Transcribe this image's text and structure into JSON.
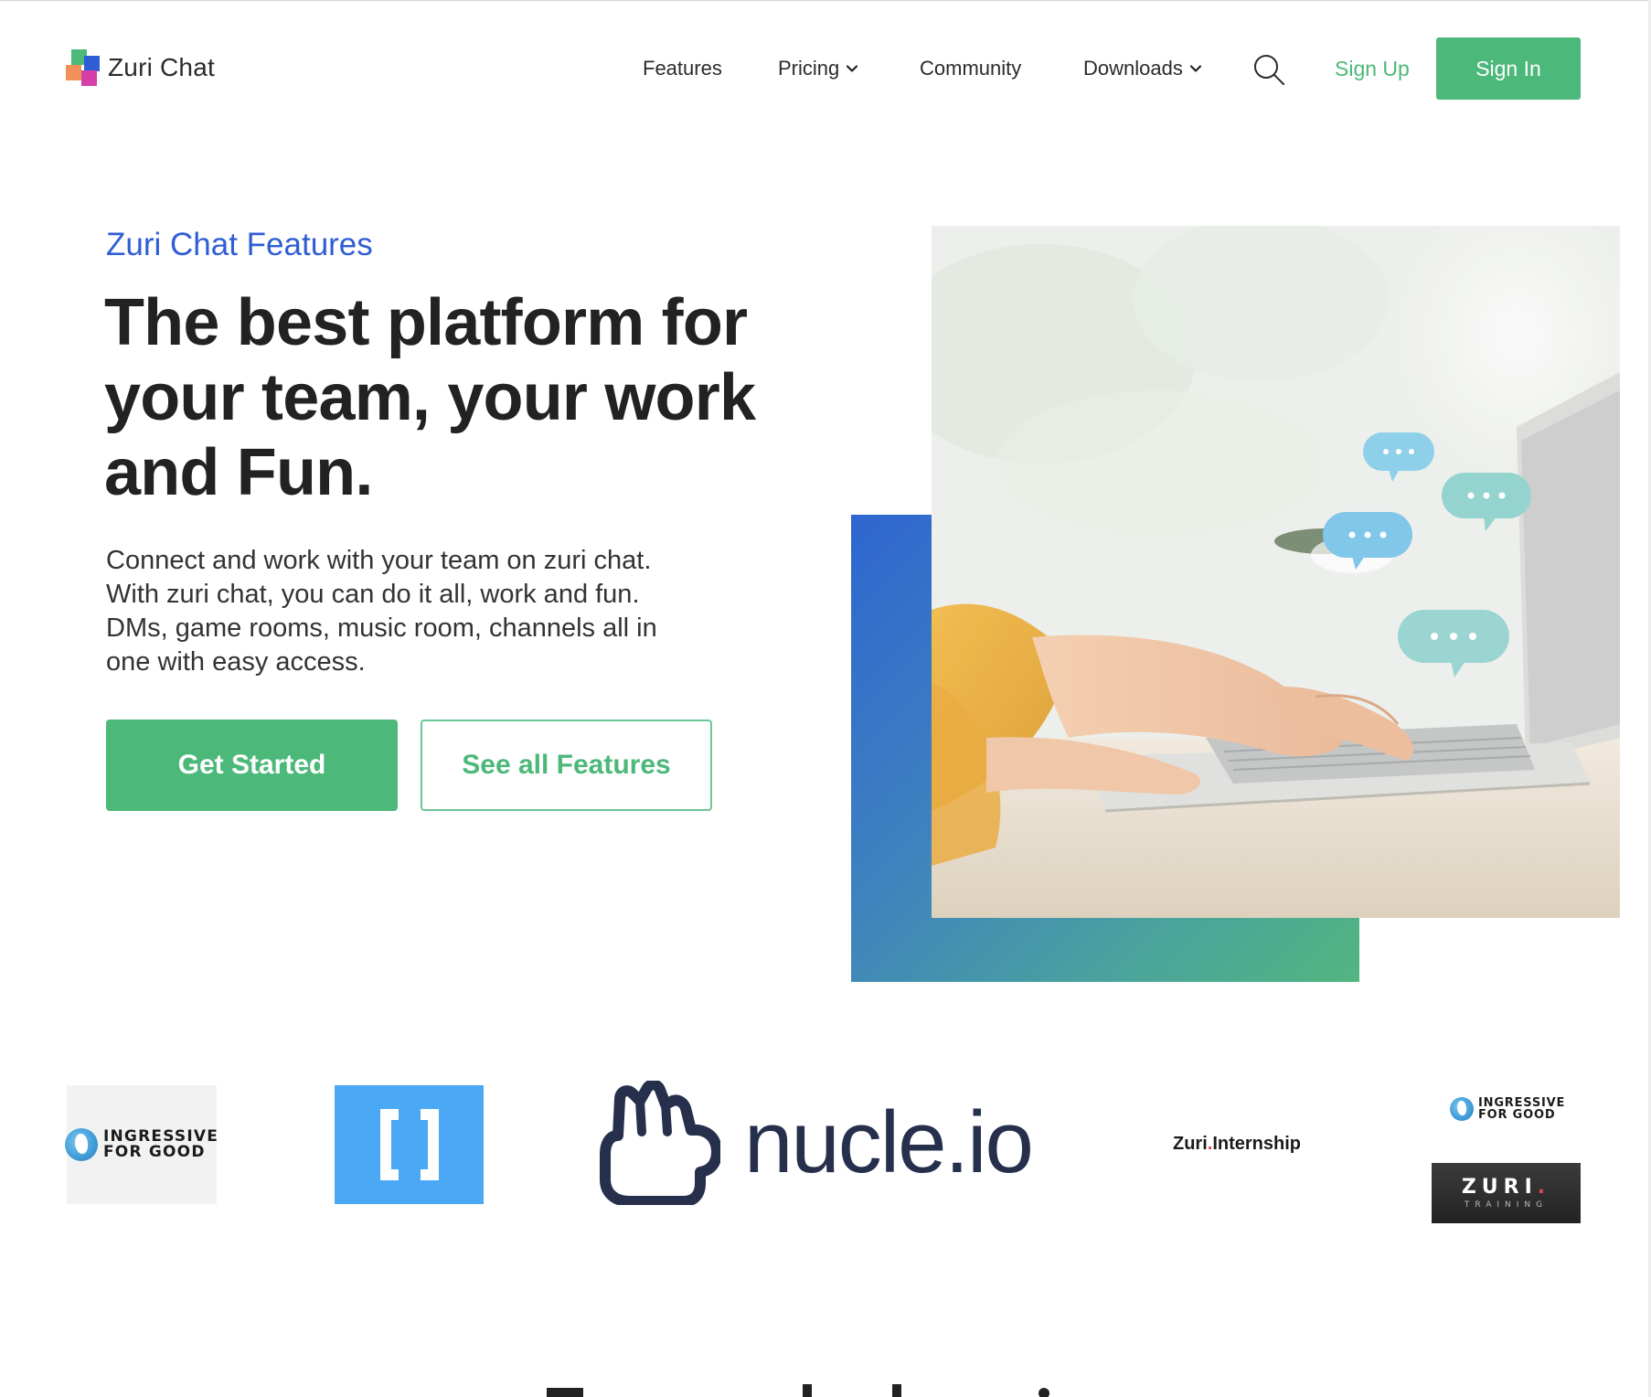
{
  "brand": {
    "name": "Zuri Chat"
  },
  "nav": {
    "items": [
      {
        "label": "Features"
      },
      {
        "label": "Pricing",
        "has_dropdown": true
      },
      {
        "label": "Community"
      },
      {
        "label": "Downloads",
        "has_dropdown": true
      }
    ],
    "search_icon": "search-icon",
    "sign_up": "Sign Up",
    "sign_in": "Sign In"
  },
  "hero": {
    "eyebrow": "Zuri Chat Features",
    "headline_lines": [
      "The best platform for",
      "your team, your work",
      "and Fun."
    ],
    "lead_lines": [
      "Connect and work with your team on zuri chat.",
      "With zuri chat, you can do it all, work and fun.",
      "DMs, game rooms, music room, channels all in",
      "one with easy access."
    ],
    "primary_cta": "Get Started",
    "secondary_cta": "See all Features"
  },
  "partners": {
    "ingressive": {
      "line1": "INGRESSIVE",
      "line2": "FOR GOOD"
    },
    "nucle": {
      "name": "nucle.io"
    },
    "zuri_internship": {
      "prefix": "Zuri",
      "dot": ".",
      "suffix": "Internship"
    },
    "zuri_training": {
      "title": "ZURI",
      "dot": ".",
      "subtitle": "TRAINING"
    }
  },
  "colors": {
    "accent_green": "#4cb87a",
    "accent_blue": "#2f5ed4",
    "text_dark": "#222222"
  }
}
